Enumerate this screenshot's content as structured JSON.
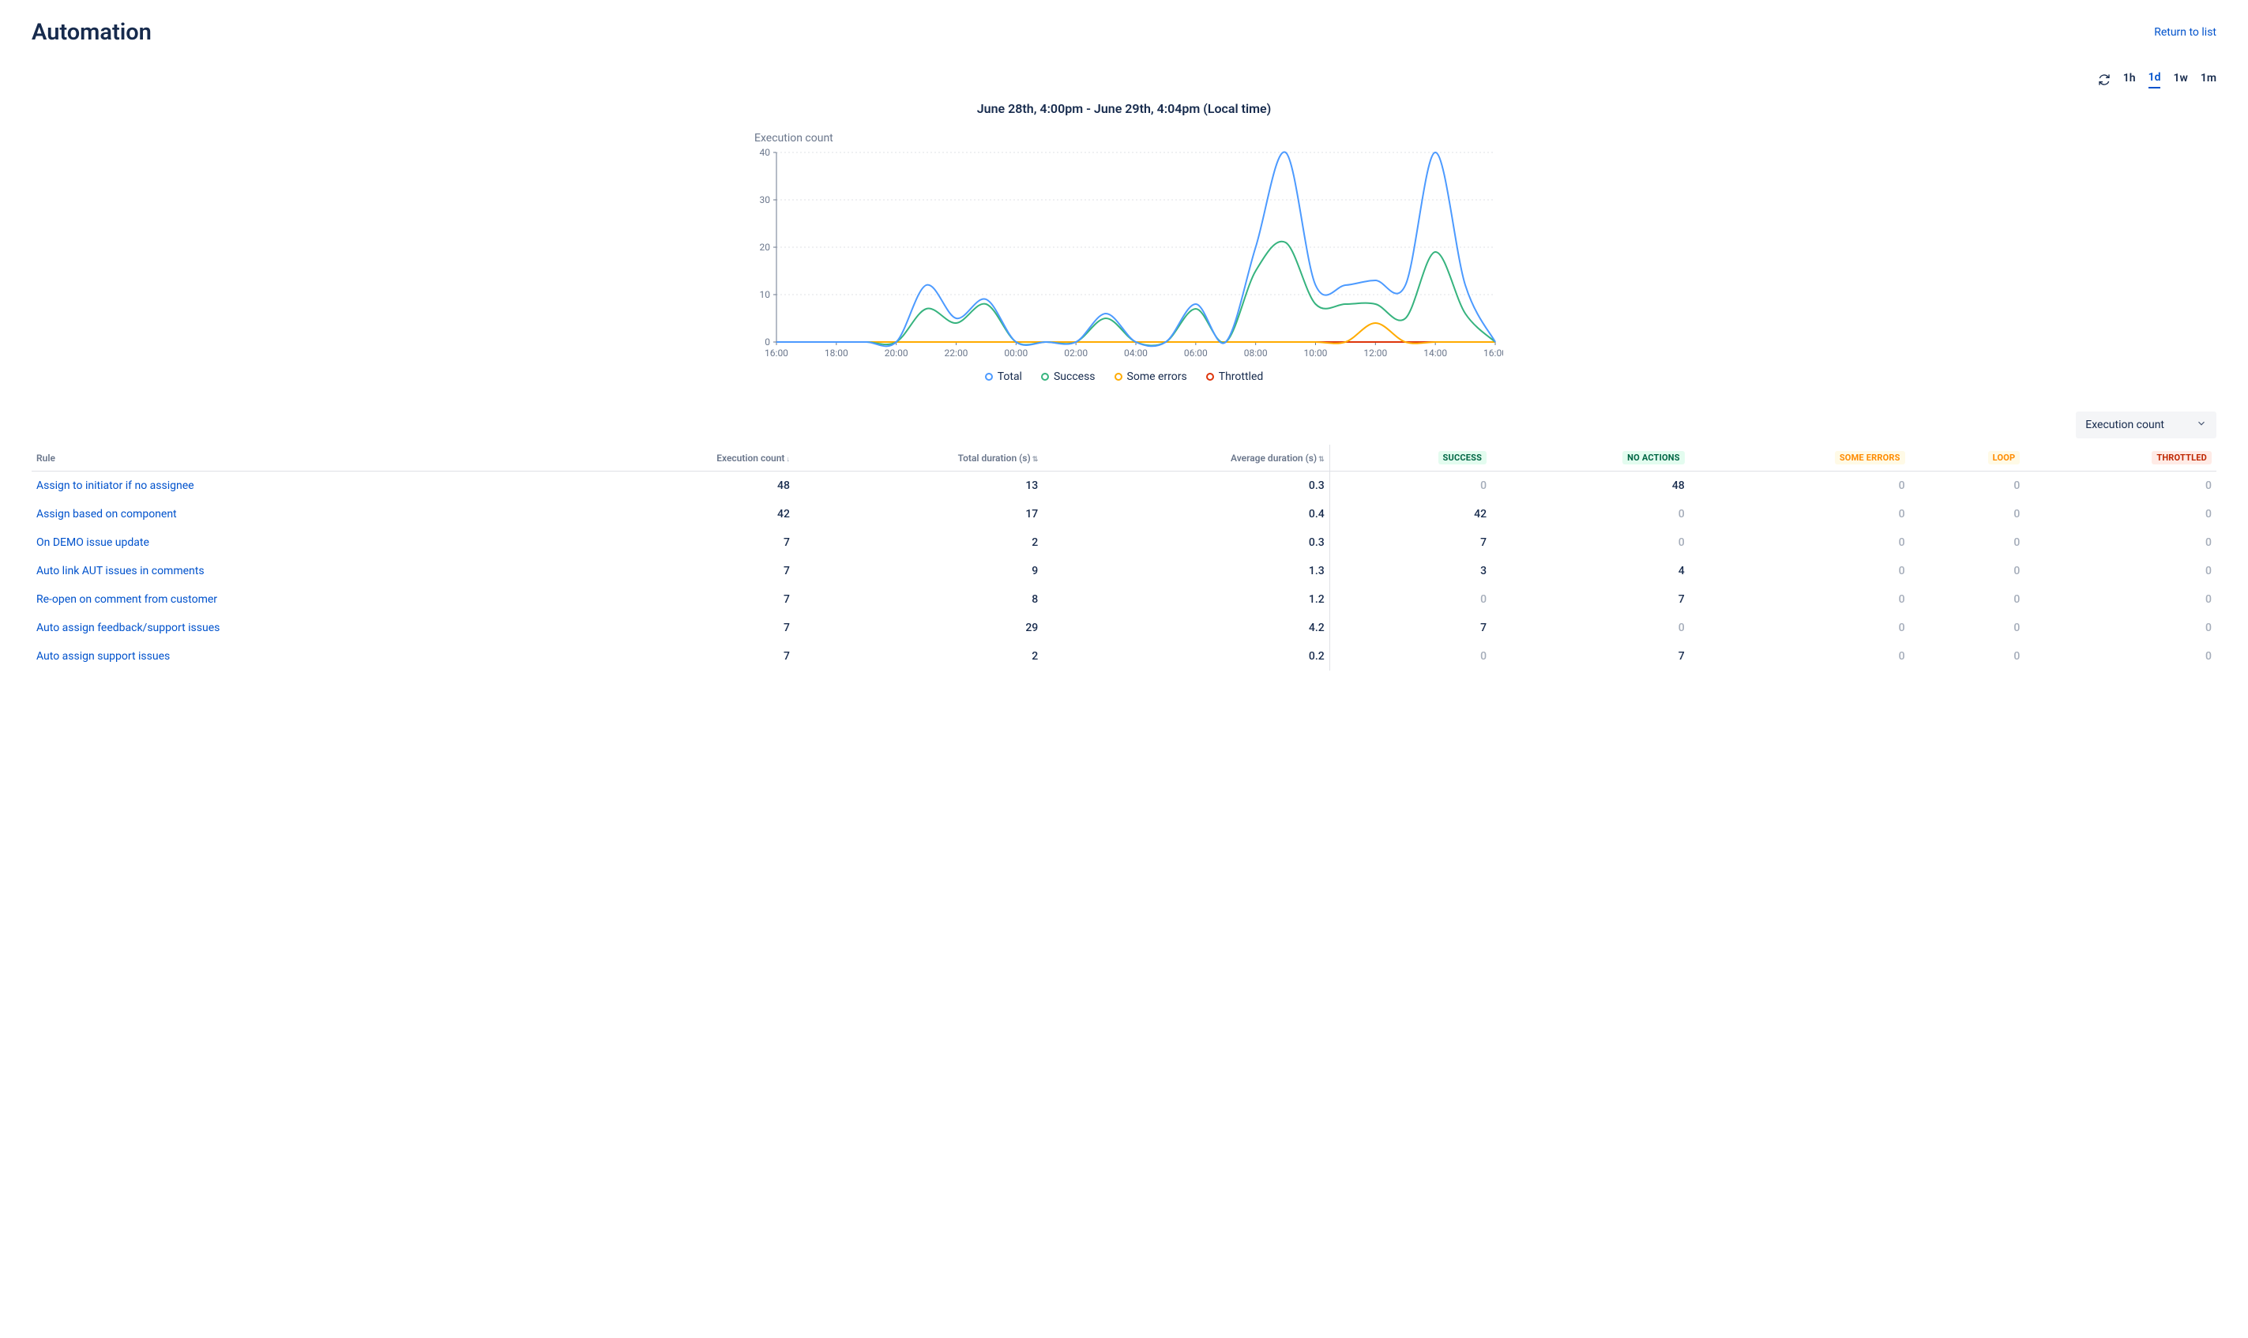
{
  "header": {
    "title": "Automation",
    "return_link": "Return to list"
  },
  "range": {
    "items": [
      "1h",
      "1d",
      "1w",
      "1m"
    ],
    "active": "1d"
  },
  "chart_title": "June 28th, 4:00pm - June 29th, 4:04pm (Local time)",
  "axis_title": "Execution count",
  "legend": {
    "total": "Total",
    "success": "Success",
    "errors": "Some errors",
    "throttled": "Throttled"
  },
  "dropdown": {
    "label": "Execution count"
  },
  "columns": {
    "rule": "Rule",
    "exec": "Execution count",
    "totdur": "Total duration (s)",
    "avgdur": "Average duration (s)",
    "success": "SUCCESS",
    "noactions": "NO ACTIONS",
    "someerrors": "SOME ERRORS",
    "loop": "LOOP",
    "throttled": "THROTTLED"
  },
  "rows": [
    {
      "rule": "Assign to initiator if no assignee",
      "exec": 48,
      "totdur": 13,
      "avgdur": "0.3",
      "success": 0,
      "noactions": 48,
      "someerrors": 0,
      "loop": 0,
      "throttled": 0
    },
    {
      "rule": "Assign based on component",
      "exec": 42,
      "totdur": 17,
      "avgdur": "0.4",
      "success": 42,
      "noactions": 0,
      "someerrors": 0,
      "loop": 0,
      "throttled": 0
    },
    {
      "rule": "On DEMO issue update",
      "exec": 7,
      "totdur": 2,
      "avgdur": "0.3",
      "success": 7,
      "noactions": 0,
      "someerrors": 0,
      "loop": 0,
      "throttled": 0
    },
    {
      "rule": "Auto link AUT issues in comments",
      "exec": 7,
      "totdur": 9,
      "avgdur": "1.3",
      "success": 3,
      "noactions": 4,
      "someerrors": 0,
      "loop": 0,
      "throttled": 0
    },
    {
      "rule": "Re-open on comment from customer",
      "exec": 7,
      "totdur": 8,
      "avgdur": "1.2",
      "success": 0,
      "noactions": 7,
      "someerrors": 0,
      "loop": 0,
      "throttled": 0
    },
    {
      "rule": "Auto assign feedback/support issues",
      "exec": 7,
      "totdur": 29,
      "avgdur": "4.2",
      "success": 7,
      "noactions": 0,
      "someerrors": 0,
      "loop": 0,
      "throttled": 0
    },
    {
      "rule": "Auto assign support issues",
      "exec": 7,
      "totdur": 2,
      "avgdur": "0.2",
      "success": 0,
      "noactions": 7,
      "someerrors": 0,
      "loop": 0,
      "throttled": 0
    }
  ],
  "chart_data": {
    "type": "line",
    "title": "June 28th, 4:00pm - June 29th, 4:04pm (Local time)",
    "ylabel": "Execution count",
    "ylim": [
      0,
      40
    ],
    "yticks": [
      0,
      10,
      20,
      30,
      40
    ],
    "x": [
      "16:00",
      "17:00",
      "18:00",
      "19:00",
      "20:00",
      "21:00",
      "22:00",
      "23:00",
      "00:00",
      "01:00",
      "02:00",
      "03:00",
      "04:00",
      "05:00",
      "06:00",
      "07:00",
      "08:00",
      "09:00",
      "10:00",
      "11:00",
      "12:00",
      "13:00",
      "14:00",
      "15:00",
      "16:00"
    ],
    "xtick_labels": [
      "16:00",
      "18:00",
      "20:00",
      "22:00",
      "00:00",
      "02:00",
      "04:00",
      "06:00",
      "08:00",
      "10:00",
      "12:00",
      "14:00",
      "16:00"
    ],
    "series": [
      {
        "name": "Total",
        "color": "#4C9AFF",
        "values": [
          0,
          0,
          0,
          0,
          0,
          12,
          5,
          9,
          0,
          0,
          0,
          6,
          0,
          0,
          8,
          0,
          20,
          40,
          12,
          12,
          13,
          12,
          40,
          12,
          0
        ]
      },
      {
        "name": "Success",
        "color": "#36B37E",
        "values": [
          0,
          0,
          0,
          0,
          0,
          7,
          4,
          8,
          0,
          0,
          0,
          5,
          0,
          0,
          7,
          0,
          15,
          21,
          8,
          8,
          8,
          5,
          19,
          6,
          0
        ]
      },
      {
        "name": "Some errors",
        "color": "#FFAB00",
        "values": [
          0,
          0,
          0,
          0,
          0,
          0,
          0,
          0,
          0,
          0,
          0,
          0,
          0,
          0,
          0,
          0,
          0,
          0,
          0,
          0,
          4,
          0,
          0,
          0,
          0
        ]
      },
      {
        "name": "Throttled",
        "color": "#DE350B",
        "values": [
          0,
          0,
          0,
          0,
          0,
          0,
          0,
          0,
          0,
          0,
          0,
          0,
          0,
          0,
          0,
          0,
          0,
          0,
          0,
          0,
          0,
          0,
          0,
          0,
          0
        ]
      }
    ]
  }
}
